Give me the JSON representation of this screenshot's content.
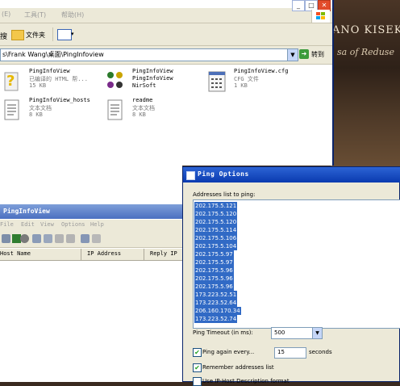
{
  "desktop": {
    "title": "ANO KISEK",
    "subtitle": "sa of Reduse"
  },
  "explorer": {
    "menu": [
      "(E)",
      "工具(T)",
      "帮助(H)"
    ],
    "toolbar_folders": "文件夹",
    "address": "s\\Frank Wang\\桌面\\PingInfoview",
    "go_label": "转到",
    "files": [
      {
        "name": "PingInfoView",
        "line2": "已编译的 HTML 帮...",
        "line3": "15 KB",
        "icon": "help-file-icon"
      },
      {
        "name": "PingInfoView",
        "line2": "PingInfoView",
        "line3": "NirSoft",
        "icon": "app-icon"
      },
      {
        "name": "PingInfoView.cfg",
        "line2": "CFG 文件",
        "line3": "1 KB",
        "icon": "cfg-file-icon"
      },
      {
        "name": "PingInfoView_hosts",
        "line2": "文本文档",
        "line3": "8 KB",
        "icon": "text-file-icon"
      },
      {
        "name": "readme",
        "line2": "文本文档",
        "line3": "8 KB",
        "icon": "text-file-icon"
      }
    ]
  },
  "pinginfoview": {
    "title": "PingInfoView",
    "menu": [
      "File",
      "Edit",
      "View",
      "Options",
      "Help"
    ],
    "columns": [
      "Host Name",
      "IP Address",
      "Reply IP"
    ]
  },
  "dialog": {
    "title": "Ping Options",
    "addresses_label": "Addresses list to ping:",
    "addresses": [
      "202.175.5.121",
      "202.175.5.120",
      "202.175.5.120",
      "202.175.5.114",
      "202.175.5.106",
      "202.175.5.104",
      "202.175.5.97",
      "202.175.5.97",
      "202.175.5.96",
      "202.175.5.96",
      "202.175.5.96",
      "173.223.52.51",
      "173.223.52.64",
      "206.160.170.34",
      "173.223.52.74"
    ],
    "timeout_label": "Ping Timeout (in ms):",
    "timeout_value": "500",
    "ping_again_label": "Ping again every...",
    "ping_again_value": "15",
    "seconds_label": "seconds",
    "remember_label": "Remember addresses list",
    "use_ip_host_label": "Use IP-Host Description format",
    "colors": {
      "selection": "#316ac5",
      "titlebar": "#0a3bb0",
      "dialog_bg": "#ece9d8"
    }
  }
}
